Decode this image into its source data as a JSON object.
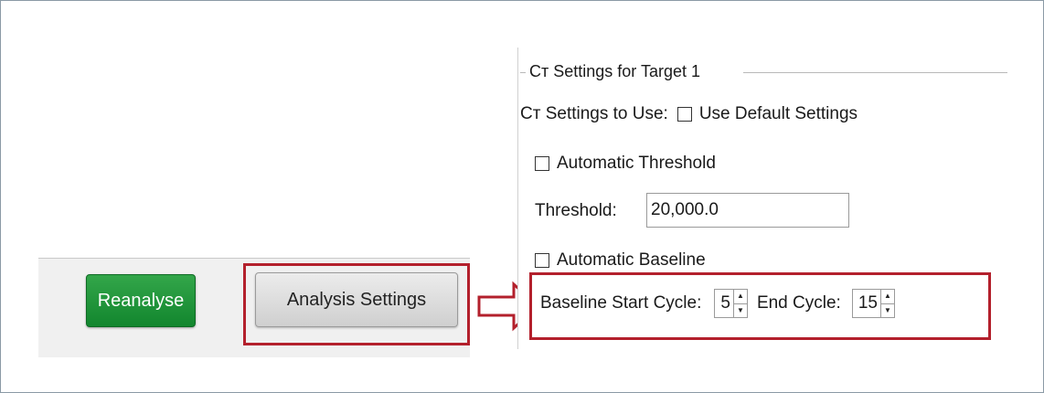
{
  "toolbar": {
    "reanalyse_label": "Reanalyse",
    "analysis_settings_label": "Analysis Settings"
  },
  "settings": {
    "group_title": "Cт Settings for Target 1",
    "settings_to_use_label": "Cт Settings to Use:",
    "use_default_label": "Use Default Settings",
    "use_default_checked": false,
    "auto_threshold_label": "Automatic Threshold",
    "auto_threshold_checked": false,
    "threshold_label": "Threshold:",
    "threshold_value": "20,000.0",
    "auto_baseline_label": "Automatic Baseline",
    "auto_baseline_checked": false,
    "baseline_start_label": "Baseline Start Cycle:",
    "baseline_start_value": "5",
    "end_cycle_label": "End Cycle:",
    "end_cycle_value": "15"
  },
  "colors": {
    "highlight": "#b3202c",
    "reanalyse_button": "#1f9a3a"
  },
  "icons": {
    "arrow": "right-arrow-icon",
    "spin_up": "spin-up-icon",
    "spin_down": "spin-down-icon"
  }
}
